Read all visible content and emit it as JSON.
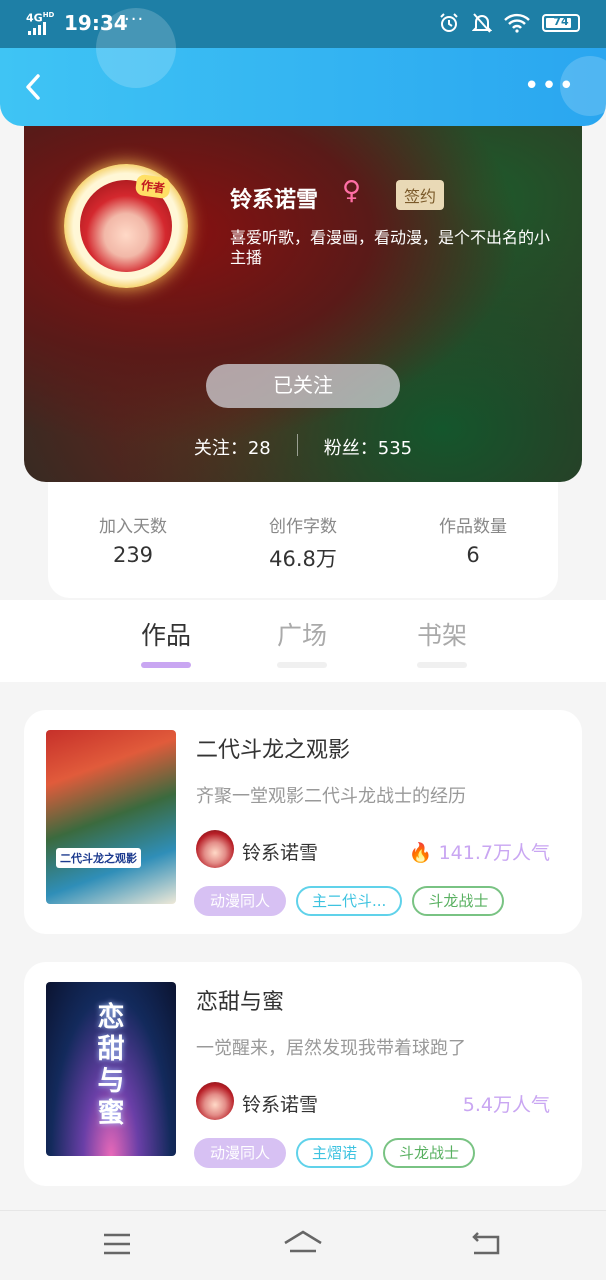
{
  "status_bar": {
    "network": "4G",
    "network_sup": "HD",
    "time": "19:34",
    "more_dots": "···",
    "battery": "74"
  },
  "header": {
    "back_icon": "chevron-left-icon",
    "more_icon": "more-dots-icon",
    "more_glyph": "•••"
  },
  "profile": {
    "avatar_tag": "作者",
    "name": "铃系诺雪",
    "gender_icon": "female-icon",
    "gender_glyph": "♀",
    "badge": "签约",
    "bio": "喜爱听歌，看漫画，看动漫，是个不出名的小主播",
    "follow_button": "已关注",
    "following_label": "关注：28",
    "fans_label": "粉丝：535"
  },
  "stats": [
    {
      "label": "加入天数",
      "value": "239"
    },
    {
      "label": "创作字数",
      "value": "46.8万"
    },
    {
      "label": "作品数量",
      "value": "6"
    }
  ],
  "tabs": [
    {
      "label": "作品",
      "active": true
    },
    {
      "label": "广场",
      "active": false
    },
    {
      "label": "书架",
      "active": false
    }
  ],
  "books": [
    {
      "title": "二代斗龙之观影",
      "cover_label": "二代斗龙之观影",
      "description": "齐聚一堂观影二代斗龙战士的经历",
      "author": "铃系诺雪",
      "popularity": "141.7万人气",
      "hot": true,
      "tags": [
        "动漫同人",
        "主二代斗...",
        "斗龙战士"
      ]
    },
    {
      "title": "恋甜与蜜",
      "cover_label": "恋甜与蜜",
      "description": "一觉醒来，居然发现我带着球跑了",
      "author": "铃系诺雪",
      "popularity": "5.4万人气",
      "hot": false,
      "tags": [
        "动漫同人",
        "主熠诺",
        "斗龙战士"
      ]
    }
  ],
  "navbar": {
    "menu_icon": "menu-icon",
    "home_icon": "home-icon",
    "back_icon": "return-icon"
  },
  "colors": {
    "header": "#2aa6f0",
    "accent": "#c9a6f2",
    "tag_blue": "#3ec3e0",
    "tag_green": "#58b060"
  }
}
